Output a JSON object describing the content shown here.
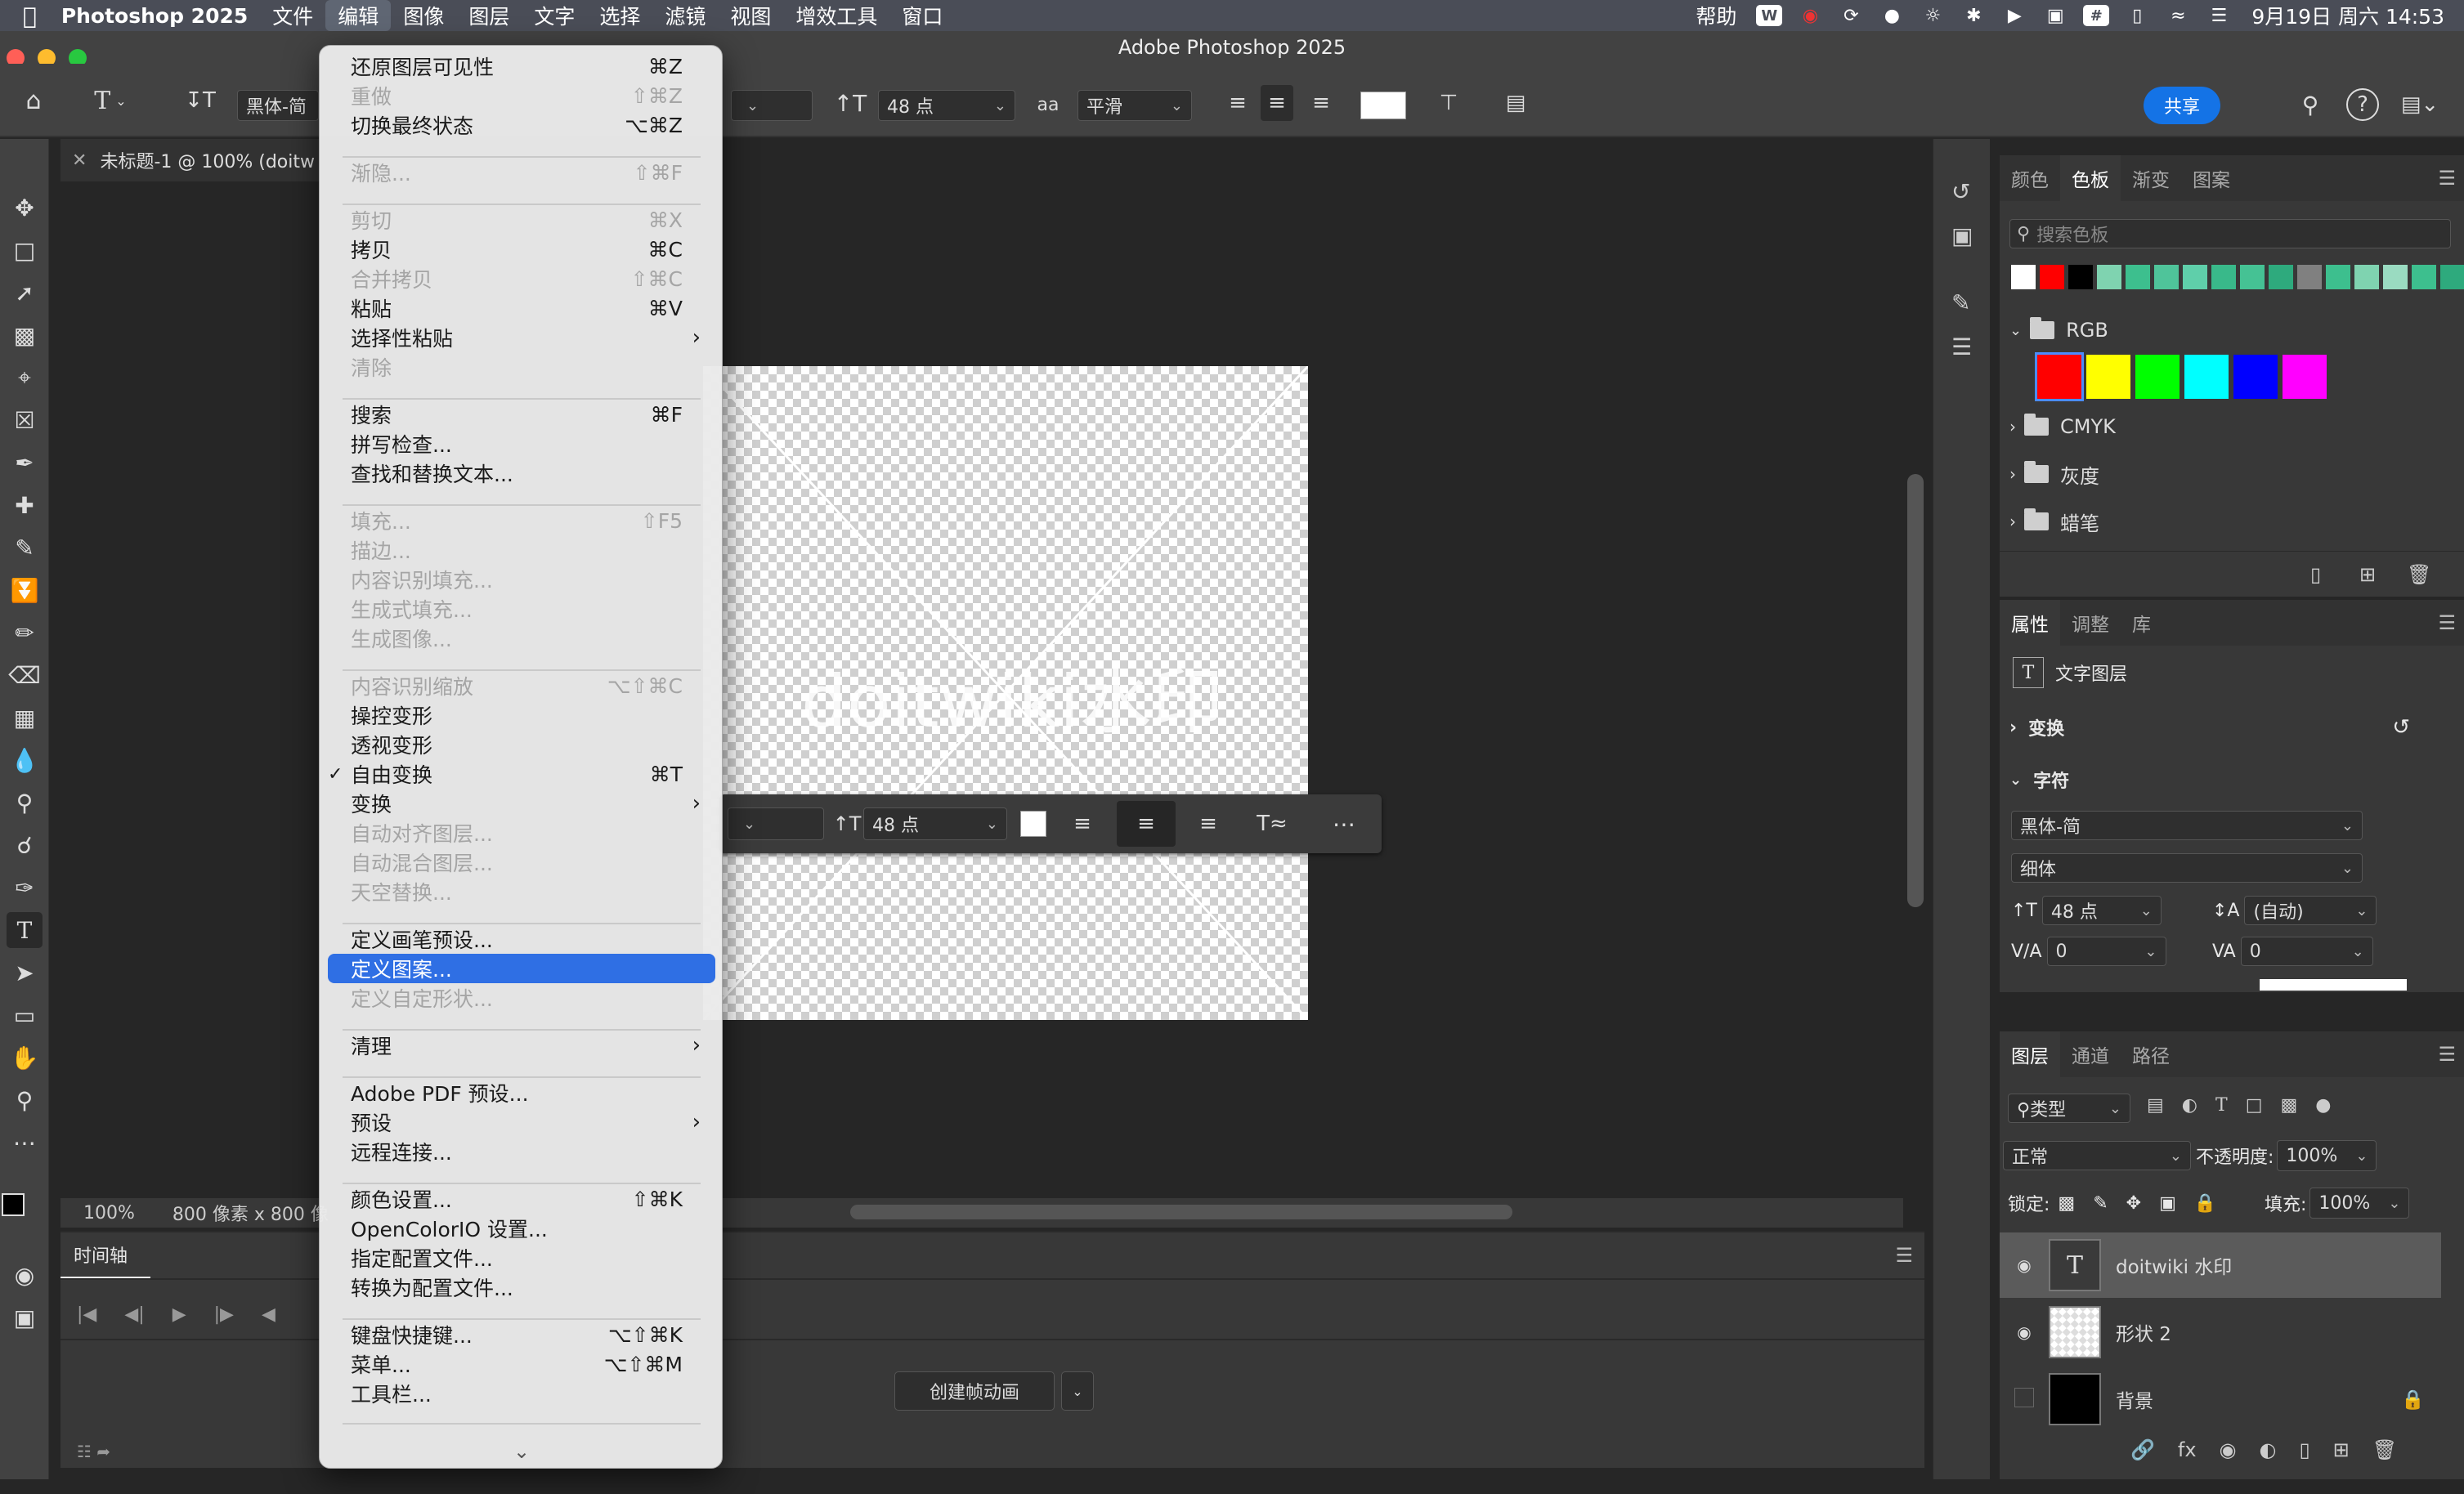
{
  "menubar": {
    "app_name": "Photoshop 2025",
    "items": [
      "文件",
      "编辑",
      "图像",
      "图层",
      "文字",
      "选择",
      "滤镜",
      "视图",
      "增效工具",
      "窗口"
    ],
    "help": "帮助",
    "clock": "9月19日 周六  14:53"
  },
  "window": {
    "title": "Adobe Photoshop 2025"
  },
  "options_bar": {
    "tool_glyph": "T",
    "font_family": "黑体-简",
    "font_size": "48 点",
    "aa_label": "aa",
    "antialias": "平滑",
    "share": "共享"
  },
  "document": {
    "tab_title": "未标题-1 @ 100% (doitw",
    "watermark_text": "doitwiki水印",
    "zoom": "100%",
    "size_info": "800 像素 x 800 像"
  },
  "context_bar": {
    "font_size": "48 点"
  },
  "timeline": {
    "tab": "时间轴",
    "create_button": "创建帧动画"
  },
  "swatches_panel": {
    "tabs": [
      "颜色",
      "色板",
      "渐变",
      "图案"
    ],
    "search_placeholder": "搜索色板",
    "swatches_top": [
      "#ffffff",
      "#ff0000",
      "#000000",
      "#7fd3b0",
      "#3dbf8e",
      "#4fc49a",
      "#5fcfaa",
      "#39b98a",
      "#45c294",
      "#2eaa7d",
      "#808080",
      "#3dbf8e",
      "#7fd3b0",
      "#9adbc1",
      "#3dbf8e",
      "#2eaa7d"
    ],
    "groups": [
      {
        "name": "RGB",
        "colors": [
          "#ff0000",
          "#ffff00",
          "#00ff00",
          "#00ffff",
          "#0000ff",
          "#ff00ff"
        ]
      },
      {
        "name": "CMYK"
      },
      {
        "name": "灰度"
      },
      {
        "name": "蜡笔"
      }
    ]
  },
  "properties_panel": {
    "tabs": [
      "属性",
      "调整",
      "库"
    ],
    "layer_type": "文字图层",
    "transform": "变换",
    "character": "字符",
    "font_family": "黑体-简",
    "font_style": "细体",
    "font_size": "48 点",
    "leading": "(自动)",
    "kerning": "0",
    "tracking": "0"
  },
  "layers_panel": {
    "tabs": [
      "图层",
      "通道",
      "路径"
    ],
    "filter": "类型",
    "blend_mode": "正常",
    "opacity_label": "不透明度:",
    "opacity": "100%",
    "lock_label": "锁定:",
    "fill_label": "填充:",
    "fill": "100%",
    "layers": [
      {
        "name": "doitwiki 水印",
        "selected": true
      },
      {
        "name": "形状 2"
      },
      {
        "name": "背景",
        "locked": true
      }
    ]
  },
  "edit_menu": {
    "items": [
      {
        "label": "还原图层可见性",
        "shortcut": "⌘Z"
      },
      {
        "label": "重做",
        "shortcut": "⇧⌘Z",
        "disabled": true
      },
      {
        "label": "切换最终状态",
        "shortcut": "⌥⌘Z"
      },
      {
        "label": "渐隐...",
        "shortcut": "⇧⌘F",
        "disabled": true
      },
      {
        "label": "剪切",
        "shortcut": "⌘X",
        "disabled": true
      },
      {
        "label": "拷贝",
        "shortcut": "⌘C"
      },
      {
        "label": "合并拷贝",
        "shortcut": "⇧⌘C",
        "disabled": true
      },
      {
        "label": "粘贴",
        "shortcut": "⌘V"
      },
      {
        "label": "选择性粘贴",
        "submenu": true
      },
      {
        "label": "清除",
        "disabled": true
      },
      {
        "label": "搜索",
        "shortcut": "⌘F"
      },
      {
        "label": "拼写检查..."
      },
      {
        "label": "查找和替换文本..."
      },
      {
        "label": "填充...",
        "shortcut": "⇧F5",
        "disabled": true
      },
      {
        "label": "描边...",
        "disabled": true
      },
      {
        "label": "内容识别填充...",
        "disabled": true
      },
      {
        "label": "生成式填充...",
        "disabled": true
      },
      {
        "label": "生成图像...",
        "disabled": true
      },
      {
        "label": "内容识别缩放",
        "shortcut": "⌥⇧⌘C",
        "disabled": true
      },
      {
        "label": "操控变形"
      },
      {
        "label": "透视变形"
      },
      {
        "label": "自由变换",
        "shortcut": "⌘T",
        "checked": true
      },
      {
        "label": "变换",
        "submenu": true
      },
      {
        "label": "自动对齐图层...",
        "disabled": true
      },
      {
        "label": "自动混合图层...",
        "disabled": true
      },
      {
        "label": "天空替换...",
        "disabled": true
      },
      {
        "label": "定义画笔预设..."
      },
      {
        "label": "定义图案...",
        "highlighted": true
      },
      {
        "label": "定义自定形状...",
        "disabled": true
      },
      {
        "label": "清理",
        "submenu": true
      },
      {
        "label": "Adobe PDF 预设..."
      },
      {
        "label": "预设",
        "submenu": true
      },
      {
        "label": "远程连接..."
      },
      {
        "label": "颜色设置...",
        "shortcut": "⇧⌘K"
      },
      {
        "label": "OpenColorIO 设置..."
      },
      {
        "label": "指定配置文件..."
      },
      {
        "label": "转换为配置文件..."
      },
      {
        "label": "键盘快捷键...",
        "shortcut": "⌥⇧⌘K"
      },
      {
        "label": "菜单...",
        "shortcut": "⌥⇧⌘M"
      },
      {
        "label": "工具栏..."
      }
    ]
  }
}
